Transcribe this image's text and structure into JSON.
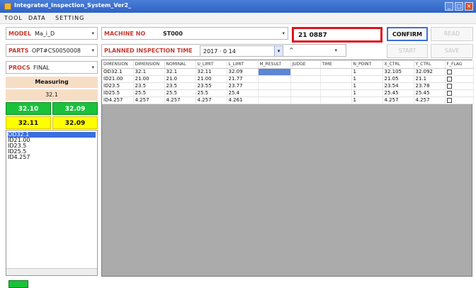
{
  "window": {
    "title": "Integrated_Inspection_System_Ver2_"
  },
  "menu": [
    "TOOL",
    "DATA",
    "SETTING"
  ],
  "left": {
    "model_label": "MODEL",
    "model_value": "Ma_i_D",
    "parts_label": "PARTS",
    "parts_value": "OPT#CS0050008",
    "proc_label": "PROCS",
    "proc_value": "FINAL",
    "measuring_label": "Measuring",
    "current_value": "32.1",
    "lower_left": "32.10",
    "lower_right": "32.09",
    "upper_left": "32.11",
    "upper_right": "32.09",
    "list": [
      "OD32.1",
      "ID21.00",
      "ID23.5",
      "ID25.5",
      "ID4.257"
    ]
  },
  "top": {
    "machine_label": "MACHINE NO",
    "machine_value": "ST000",
    "barcode": "21 0887",
    "confirm": "CONFIRM",
    "read_label": "READ BARCODE",
    "plan_label": "PLANNED INSPECTION TIME",
    "date": "2017 · 0 14",
    "start": "START",
    "save": "SAVE"
  },
  "table": {
    "headers": [
      "DIMENSION",
      "DIMENSION",
      "NOMINAL",
      "U_LIMIT",
      "L_LIMIT",
      "M_RESULT",
      "JUDGE",
      "TIME",
      "N_POINT",
      "X_CTRL",
      "Y_CTRL",
      "F_FLAG"
    ],
    "rows": [
      [
        "OD32.1",
        "32.1",
        "32.1",
        "32.11",
        "32.09",
        "",
        "",
        "",
        "1",
        "32.105",
        "32.092",
        ""
      ],
      [
        "ID21.00",
        "21.00",
        "21.0",
        "21.00",
        "21.77",
        "",
        "",
        "",
        "1",
        "21.05",
        "21.1",
        ""
      ],
      [
        "ID23.5",
        "23.5",
        "23.5",
        "23.55",
        "23.77",
        "",
        "",
        "",
        "1",
        "23.54",
        "23.78",
        ""
      ],
      [
        "ID25.5",
        "25.5",
        "25.5",
        "25.5",
        "25.4",
        "",
        "",
        "",
        "1",
        "25.45",
        "25.45",
        ""
      ],
      [
        "ID4.257",
        "4.257",
        "4.257",
        "4.257",
        "4.261",
        "",
        "",
        "",
        "1",
        "4.257",
        "4.257",
        ""
      ]
    ]
  },
  "colors": {
    "accent": "#3b6fdc",
    "ok": "#19c23a",
    "warn": "#ffff00",
    "alert": "#e0141b"
  }
}
